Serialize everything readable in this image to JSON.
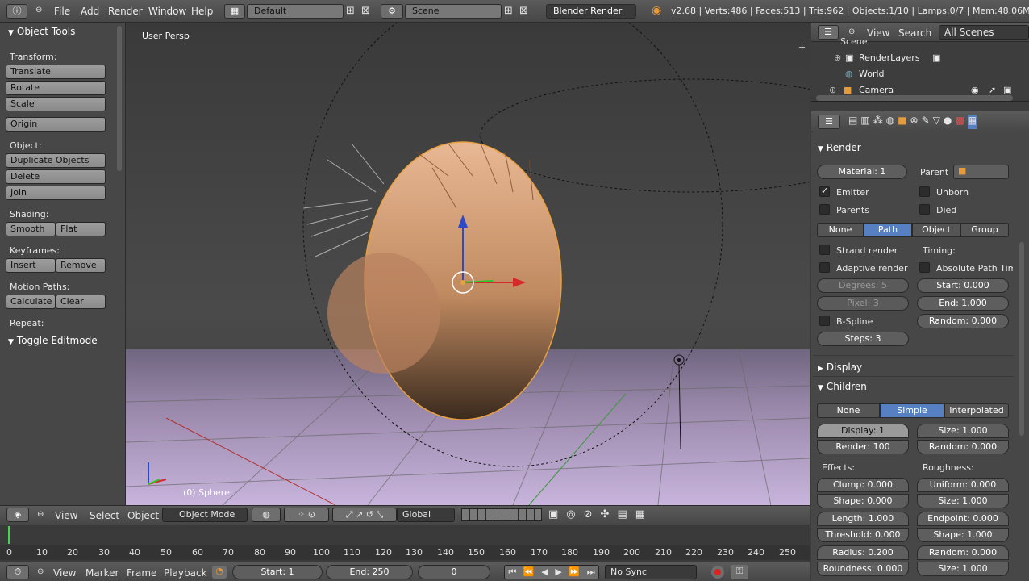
{
  "topbar": {
    "menus": [
      "File",
      "Add",
      "Render",
      "Window",
      "Help"
    ],
    "layout": "Default",
    "scene": "Scene",
    "engine": "Blender Render",
    "stats": "v2.68 | Verts:486 | Faces:513 | Tris:962 | Objects:1/10 | Lamps:0/7 | Mem:48.06M (0.5"
  },
  "toolshelf": {
    "title": "Object Tools",
    "transform_label": "Transform:",
    "translate": "Translate",
    "rotate": "Rotate",
    "scale": "Scale",
    "origin": "Origin",
    "object_label": "Object:",
    "duplicate": "Duplicate Objects",
    "delete": "Delete",
    "join": "Join",
    "shading_label": "Shading:",
    "smooth": "Smooth",
    "flat": "Flat",
    "keyframes_label": "Keyframes:",
    "insert": "Insert",
    "remove": "Remove",
    "motion_label": "Motion Paths:",
    "calculate": "Calculate",
    "clear": "Clear",
    "repeat_label": "Repeat:",
    "toggle_editmode": "Toggle Editmode"
  },
  "viewport": {
    "view_label": "User Persp",
    "object_label": "(0) Sphere"
  },
  "outliner": {
    "view": "View",
    "search": "Search",
    "filter": "All Scenes",
    "rows": [
      "Scene",
      "RenderLayers",
      "World",
      "Camera"
    ]
  },
  "properties": {
    "render_title": "Render",
    "material": "Material: 1",
    "parent_label": "Parent",
    "emitter": "Emitter",
    "unborn": "Unborn",
    "parents": "Parents",
    "died": "Died",
    "mode_tabs": [
      "None",
      "Path",
      "Object",
      "Group"
    ],
    "strand_render": "Strand render",
    "timing_label": "Timing:",
    "adaptive_render": "Adaptive render",
    "absolute_path": "Absolute Path Tim",
    "degrees": "Degrees: 5",
    "start": "Start: 0.000",
    "pixel": "Pixel: 3",
    "end": "End: 1.000",
    "bspline": "B-Spline",
    "random_timing": "Random: 0.000",
    "steps": "Steps: 3",
    "display_title": "Display",
    "children_title": "Children",
    "child_tabs": [
      "None",
      "Simple",
      "Interpolated"
    ],
    "display_amt": "Display: 1",
    "size": "Size: 1.000",
    "render_amt": "Render: 100",
    "random": "Random: 0.000",
    "effects_label": "Effects:",
    "roughness_label": "Roughness:",
    "clump": "Clump: 0.000",
    "uniform": "Uniform: 0.000",
    "shape": "Shape: 0.000",
    "size2": "Size: 1.000",
    "length": "Length: 1.000",
    "endpoint": "Endpoint: 0.000",
    "threshold": "Threshold: 0.000",
    "shape2": "Shape: 1.000",
    "radius": "Radius: 0.200",
    "random2": "Random: 0.000",
    "roundness": "Roundness: 0.000",
    "size3": "Size: 1.000"
  },
  "viewheader": {
    "view": "View",
    "select": "Select",
    "object": "Object",
    "mode": "Object Mode",
    "orientation": "Global"
  },
  "timeline": {
    "ticks": [
      "0",
      "10",
      "20",
      "30",
      "40",
      "50",
      "60",
      "70",
      "80",
      "90",
      "100",
      "110",
      "120",
      "130",
      "140",
      "150",
      "160",
      "170",
      "180",
      "190",
      "200",
      "210",
      "220",
      "230",
      "240",
      "250"
    ],
    "view": "View",
    "marker": "Marker",
    "frame": "Frame",
    "playback": "Playback",
    "start": "Start: 1",
    "end": "End: 250",
    "current": "0",
    "sync": "No Sync"
  }
}
